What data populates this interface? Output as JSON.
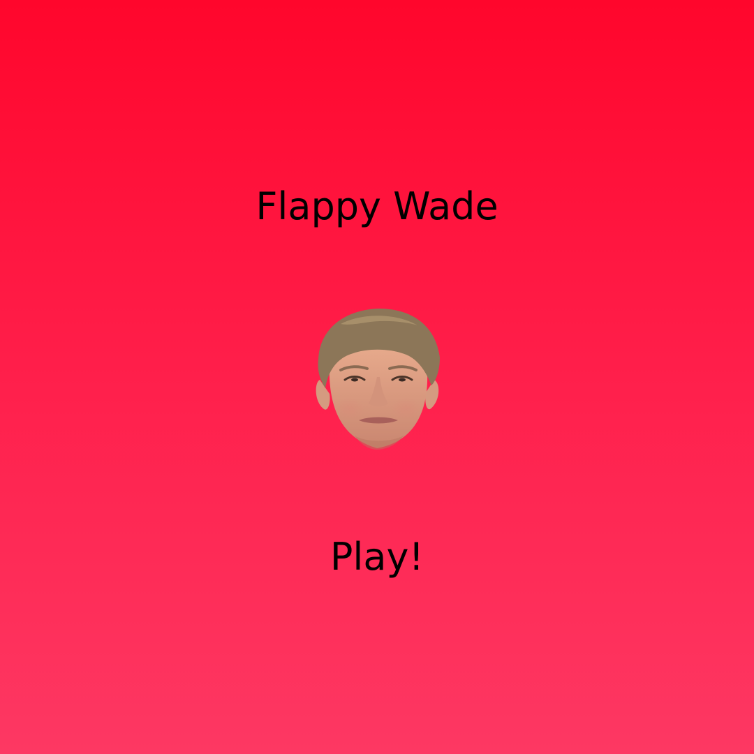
{
  "game": {
    "title": "Flappy Wade",
    "play_label": "Play!",
    "character": "face-icon"
  },
  "colors": {
    "background_top": "#ff062c",
    "background_bottom": "#fd3863",
    "text": "#000000"
  }
}
